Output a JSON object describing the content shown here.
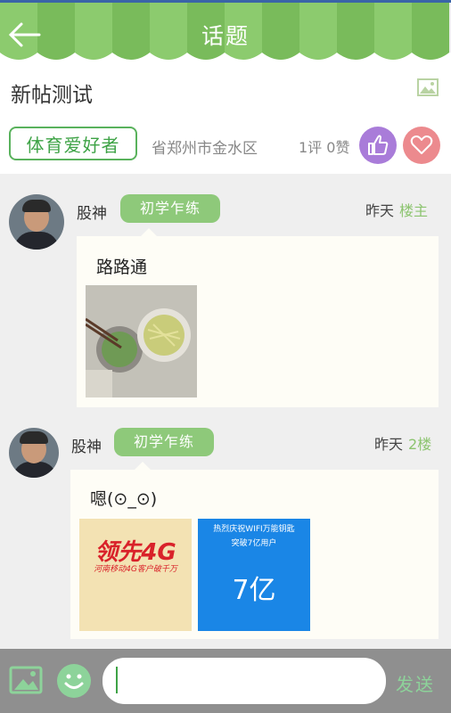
{
  "header": {
    "title": "话题"
  },
  "post": {
    "title": "新帖测试",
    "tag": "体育爱好者",
    "location": "省郑州市金水区",
    "stats": "1评 0赞"
  },
  "replies": [
    {
      "user": "股神",
      "level": "初学乍练",
      "time": "昨天",
      "floor": "楼主",
      "text": "路路通"
    },
    {
      "user": "股神",
      "level": "初学乍练",
      "time": "昨天",
      "floor": "2楼",
      "text": "嗯(⊙_⊙)",
      "images": [
        {
          "big": "领先4G",
          "small": "河南移动4G客户破千万"
        },
        {
          "top": "热烈庆祝WIFI万能钥匙",
          "mid": "突破7亿用户",
          "big": "7亿"
        }
      ]
    }
  ],
  "composer": {
    "send_label": "发送",
    "value": ""
  },
  "colors": {
    "accent": "#59b25c",
    "like": "#a97cd9",
    "heart": "#ec8a8e",
    "level_tag": "#8ec97a"
  }
}
